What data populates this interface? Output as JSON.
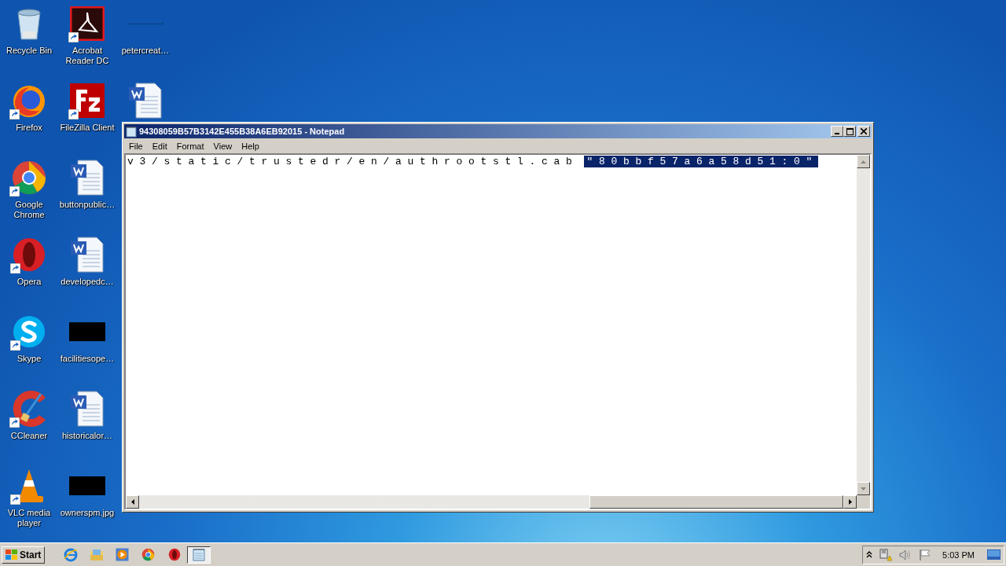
{
  "desktop_icons": [
    {
      "label": "Recycle Bin",
      "kind": "recycle-bin",
      "shortcut": false
    },
    {
      "label": "Firefox",
      "kind": "firefox",
      "shortcut": true
    },
    {
      "label": "Google Chrome",
      "kind": "chrome",
      "shortcut": true
    },
    {
      "label": "Opera",
      "kind": "opera",
      "shortcut": true
    },
    {
      "label": "Skype",
      "kind": "skype",
      "shortcut": true
    },
    {
      "label": "CCleaner",
      "kind": "ccleaner",
      "shortcut": true
    },
    {
      "label": "VLC media player",
      "kind": "vlc",
      "shortcut": true
    },
    {
      "label": "Acrobat Reader DC",
      "kind": "acrobat",
      "shortcut": true
    },
    {
      "label": "FileZilla Client",
      "kind": "filezilla",
      "shortcut": true
    },
    {
      "label": "buttonpublic…",
      "kind": "word",
      "shortcut": false
    },
    {
      "label": "developedc…",
      "kind": "word",
      "shortcut": false
    },
    {
      "label": "facilitiesope…",
      "kind": "black-image",
      "shortcut": false
    },
    {
      "label": "historicalor…",
      "kind": "word",
      "shortcut": false
    },
    {
      "label": "ownerspm.jpg",
      "kind": "black-image",
      "shortcut": false
    },
    {
      "label": "petercreat…",
      "kind": "blank-image",
      "shortcut": false
    },
    {
      "kind": "word",
      "shortcut": false
    }
  ],
  "window": {
    "title": "94308059B57B3142E455B38A6EB92015 - Notepad",
    "menu": [
      "File",
      "Edit",
      "Format",
      "View",
      "Help"
    ],
    "segments": [
      {
        "text": "v3/static/trustedr/en/authrootstl.cab",
        "selected": false
      },
      {
        "text": "\"80bbf57a6a58d51:0\"",
        "selected": true
      }
    ]
  },
  "taskbar": {
    "start": "Start",
    "apps": [
      {
        "kind": "ie",
        "active": false
      },
      {
        "kind": "explorer",
        "active": false
      },
      {
        "kind": "media",
        "active": false
      },
      {
        "kind": "chrome",
        "active": false
      },
      {
        "kind": "opera",
        "active": false
      },
      {
        "kind": "notepad",
        "active": true
      }
    ],
    "clock": "5:03 PM"
  }
}
